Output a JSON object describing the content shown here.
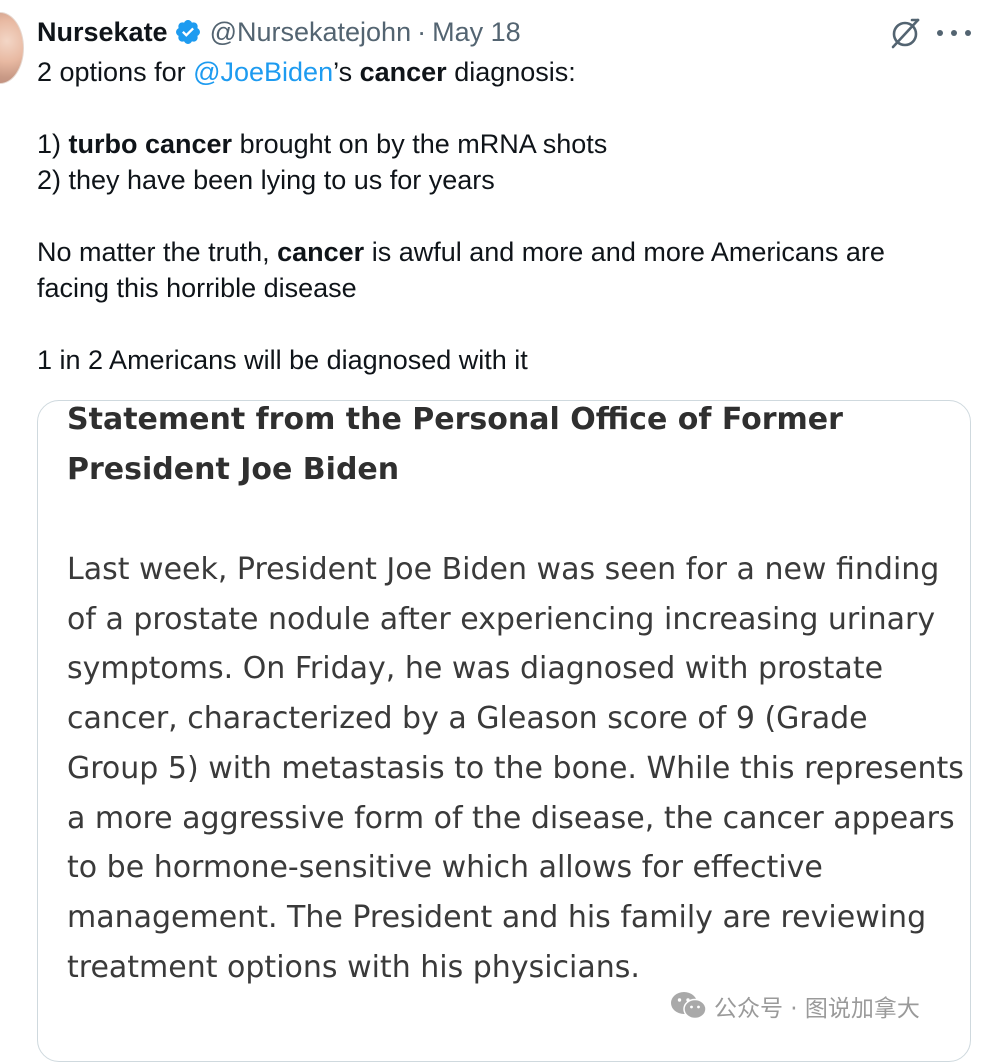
{
  "tweet": {
    "author_name": "Nursekate",
    "handle": "@Nursekatejohn",
    "separator": "·",
    "date": "May 18",
    "icons": {
      "verified": "verified-badge-icon",
      "grok": "grok-icon",
      "more": "more-options-icon"
    },
    "line1": {
      "prefix": "2 options for ",
      "mention": "@JoeBiden",
      "mid": "’s ",
      "bold": "cancer",
      "suffix": " diagnosis:"
    },
    "line2": {
      "prefix": "1) ",
      "bold": "turbo cancer",
      "suffix": " brought on by the mRNA shots"
    },
    "line3": "2) they have been lying to us for years",
    "line4": {
      "prefix": "No matter the truth, ",
      "bold": "cancer",
      "suffix": " is awful and more and more Americans are facing this horrible disease"
    },
    "line5": "1 in 2 Americans will be diagnosed with it"
  },
  "media": {
    "title": "Statement from the Personal Office of Former President Joe Biden",
    "body": "Last week, President Joe Biden was seen for a new finding of a prostate nodule after experiencing increasing urinary symptoms. On Friday, he was diagnosed with prostate cancer, characterized by a Gleason score of 9 (Grade Group 5) with metastasis to the bone. While this represents a more aggressive form of the disease, the cancer appears to be hormone-sensitive which allows for effective management. The President and his family are reviewing treatment options with his physicians."
  },
  "watermark": {
    "text": "公众号 · 图说加拿大",
    "icon": "wechat-icon"
  },
  "colors": {
    "link": "#1d9bf0",
    "verified": "#1d9bf0",
    "secondary_text": "#536471",
    "primary_text": "#0f1419"
  }
}
